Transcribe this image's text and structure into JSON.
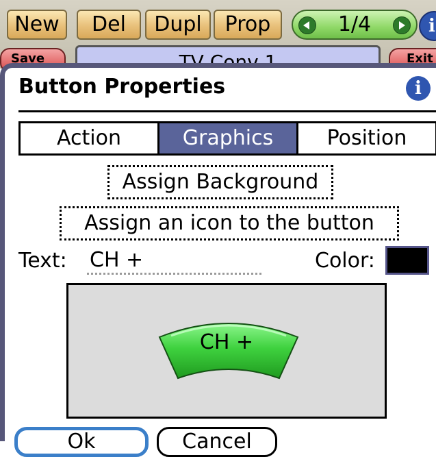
{
  "toolbar": {
    "new_label": "New",
    "del_label": "Del",
    "dupl_label": "Dupl",
    "prop_label": "Prop",
    "page_indicator": "1/4",
    "info_glyph": "i",
    "save_label": "Save",
    "screen_title": "TV Conv 1",
    "exit_label": "Exit"
  },
  "dialog": {
    "title": "Button Properties",
    "info_glyph": "i",
    "tabs": [
      {
        "label": "Action",
        "active": false
      },
      {
        "label": "Graphics",
        "active": true
      },
      {
        "label": "Position",
        "active": false
      }
    ],
    "assign_background_label": "Assign Background",
    "assign_icon_label": "Assign an icon to the button",
    "text_label": "Text:",
    "text_value": "CH +",
    "color_label": "Color:",
    "color_value": "#000000",
    "preview_button_label": "CH +",
    "ok_label": "Ok",
    "cancel_label": "Cancel"
  },
  "colors": {
    "tab_active": "#5a649a",
    "preview_button": "#3fd23f",
    "dialog_frame": "#57577a",
    "ok_focus": "#3b7fc9"
  },
  "icons": {
    "info": "info-icon",
    "prev": "arrow-left-icon",
    "next": "arrow-right-icon"
  }
}
